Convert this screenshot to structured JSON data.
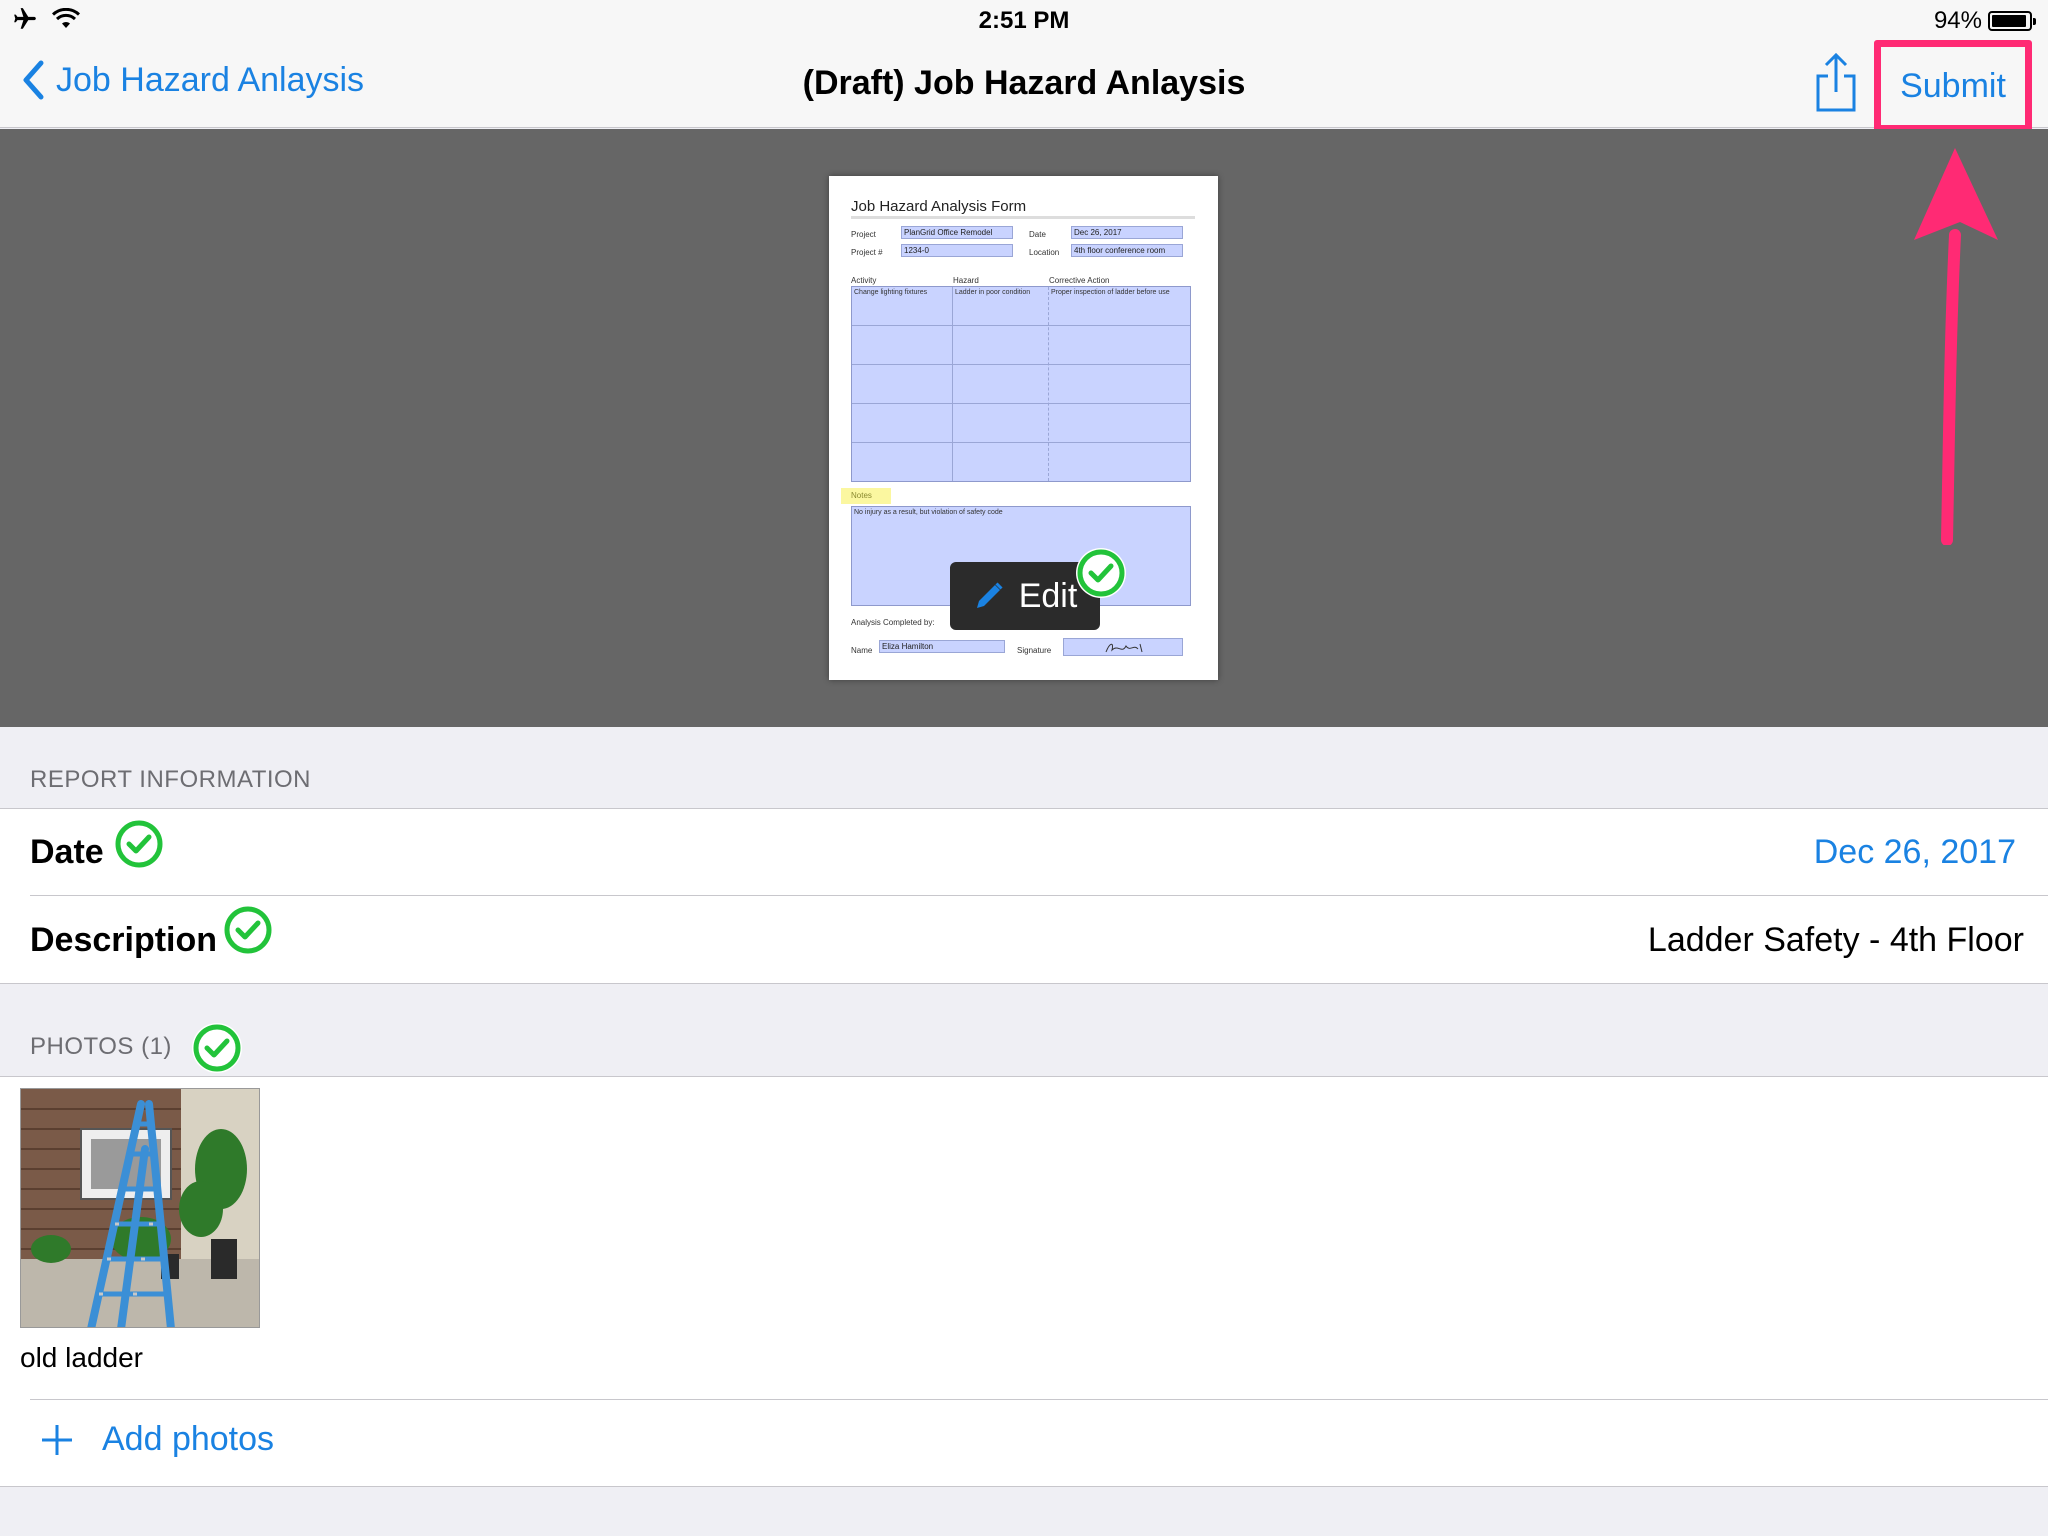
{
  "status_bar": {
    "time": "2:51 PM",
    "battery_percent": "94%",
    "battery_level": 0.94
  },
  "nav": {
    "back_label": "Job Hazard Anlaysis",
    "title": "(Draft) Job Hazard Anlaysis",
    "submit_label": "Submit"
  },
  "document": {
    "title": "Job Hazard Analysis Form",
    "project_label": "Project",
    "project_value": "PlanGrid Office Remodel",
    "date_label": "Date",
    "date_value": "Dec 26, 2017",
    "project_num_label": "Project #",
    "project_num_value": "1234-0",
    "location_label": "Location",
    "location_value": "4th floor conference room",
    "col_activity": "Activity",
    "col_hazard": "Hazard",
    "col_action": "Corrective Action",
    "row1_activity": "Change lighting fixtures",
    "row1_hazard": "Ladder in poor condition",
    "row1_action": "Proper inspection of ladder before use",
    "notes_label": "Notes",
    "notes_value": "No injury as a result, but violation of safety code",
    "completed_label": "Analysis Completed by:",
    "name_label": "Name",
    "name_value": "Eliza Hamilton",
    "signature_label": "Signature"
  },
  "edit_label": "Edit",
  "report": {
    "header": "REPORT INFORMATION",
    "date_label": "Date",
    "date_value": "Dec 26, 2017",
    "description_label": "Description",
    "description_value": "Ladder Safety - 4th Floor"
  },
  "photos": {
    "header": "PHOTOS (1)",
    "items": [
      {
        "caption": "old ladder"
      }
    ],
    "add_label": "Add photos"
  },
  "colors": {
    "accent": "#1a82e2",
    "highlight": "#ff2a74",
    "check_green": "#22c33a"
  }
}
